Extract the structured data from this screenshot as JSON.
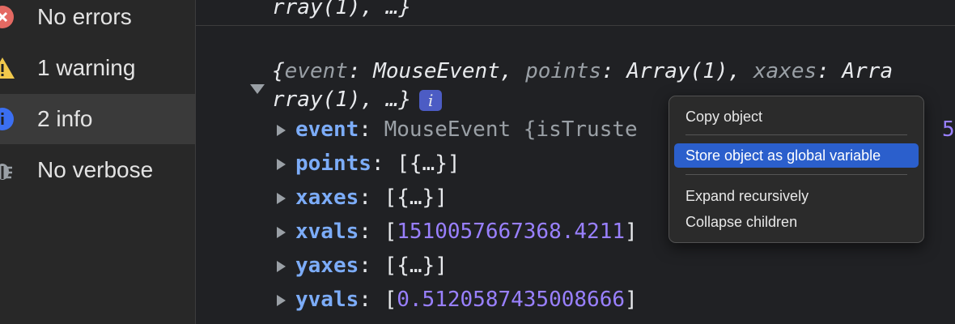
{
  "sidebar": {
    "items": [
      {
        "label": "No errors",
        "icon": "error-icon",
        "selected": false
      },
      {
        "label": "1 warning",
        "icon": "warning-icon",
        "selected": false
      },
      {
        "label": "2 info",
        "icon": "info-icon",
        "selected": true
      },
      {
        "label": "No verbose",
        "icon": "bug-icon",
        "selected": false
      }
    ]
  },
  "console": {
    "prev_line_tail": "rray(1), …}",
    "summary": {
      "open": "{",
      "k1": "event",
      "v1": "MouseEvent",
      "k2": "points",
      "v2": "Array(1)",
      "k3": "xaxes",
      "v3": "Arra",
      "cont": "rray(1), …}",
      "badge": "i"
    },
    "props": [
      {
        "key": "event",
        "value": "MouseEvent {isTruste",
        "trail": "5"
      },
      {
        "key": "points",
        "value": "[{…}]"
      },
      {
        "key": "xaxes",
        "value": "[{…}]"
      },
      {
        "key": "xvals",
        "open": "[",
        "num": "1510057667368.4211",
        "close": "]"
      },
      {
        "key": "yaxes",
        "value": "[{…}]"
      },
      {
        "key": "yvals",
        "open": "[",
        "num": "0.5120587435008666",
        "close": "]"
      }
    ]
  },
  "context_menu": {
    "items": [
      "Copy object",
      "Store object as global variable",
      "Expand recursively",
      "Collapse children"
    ],
    "active_index": 1
  },
  "colors": {
    "background": "#202124",
    "key": "#7cacf8",
    "number": "#9980ff",
    "menu_highlight": "#2b5fcc",
    "error": "#e46962",
    "warning": "#f2c94c",
    "info": "#3b6ff2"
  }
}
